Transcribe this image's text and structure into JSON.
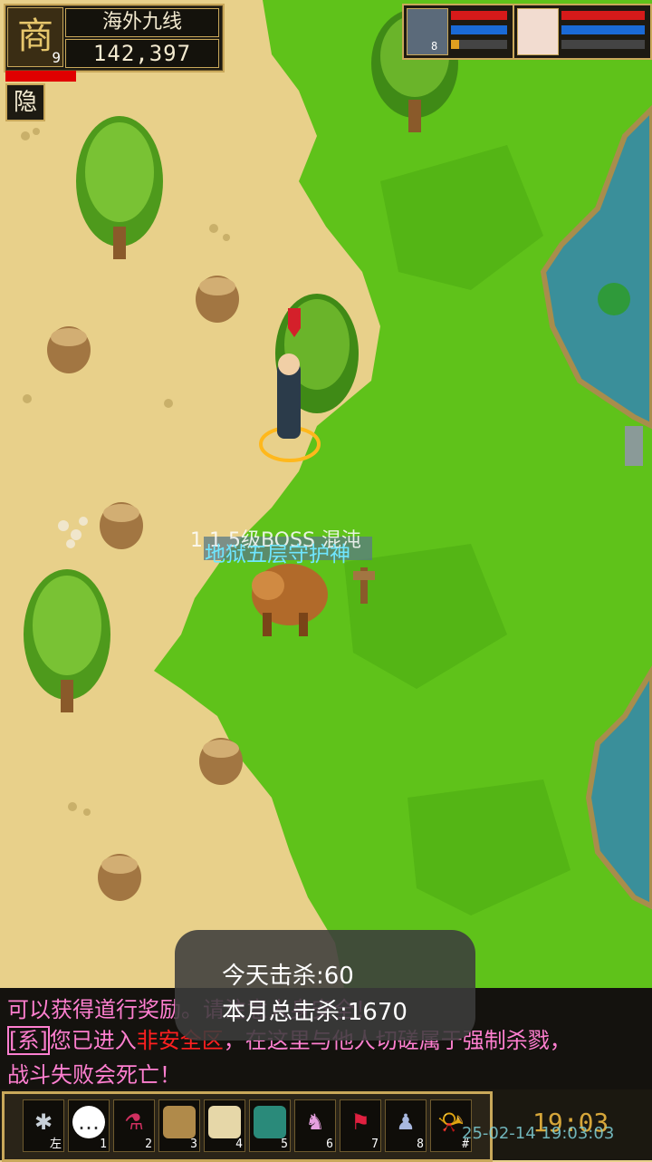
{
  "player": {
    "portrait_glyph": "商",
    "level": "9",
    "server_name": "海外九线",
    "gold": "142,397",
    "hp_fraction": 1.0,
    "hide_label": "隐"
  },
  "party": [
    {
      "level": "8",
      "hp_fraction": 1.0,
      "mp_fraction": 1.0,
      "xp_fraction": 0.15
    },
    {
      "level": "",
      "hp_fraction": 1.0,
      "mp_fraction": 1.0,
      "xp_fraction": 0.0
    }
  ],
  "world": {
    "player_title": "1 1 5级BOSS 混沌",
    "npc_name": "地狱五层守护神"
  },
  "toast": {
    "today_kills": "今天击杀:60",
    "month_kills": "本月总击杀:1670"
  },
  "chat": {
    "line1": "可以获得道行奖励。请注意人身安全！",
    "line2_tag": "[系]",
    "line2_a": "您已进入",
    "line2_b": "非安全区",
    "line2_c": "，在这里与他人切磋属于强制杀戮，",
    "line3": "战斗失败会死亡！"
  },
  "skills": [
    {
      "num": "左",
      "icon": "settings-icon"
    },
    {
      "num": "1",
      "icon": "chat-bubble-icon"
    },
    {
      "num": "2",
      "icon": "potion-icon"
    },
    {
      "num": "3",
      "icon": "bag-icon"
    },
    {
      "num": "4",
      "icon": "scroll-icon"
    },
    {
      "num": "5",
      "icon": "card-icon"
    },
    {
      "num": "6",
      "icon": "pet-icon"
    },
    {
      "num": "7",
      "icon": "flag-icon"
    },
    {
      "num": "8",
      "icon": "team-icon"
    },
    {
      "num": "#",
      "icon": "horn-icon"
    }
  ],
  "clock": "19:03",
  "timestamp": "25-02-14 19:03:03",
  "colors": {
    "sand": "#e8d08a",
    "grass": "#5fc21a",
    "water": "#3a8f9a",
    "gold_border": "#c9a85a",
    "chat_pink": "#ff7fd0",
    "chat_red": "#ff2020",
    "npc_name": "#6fe6ff"
  }
}
